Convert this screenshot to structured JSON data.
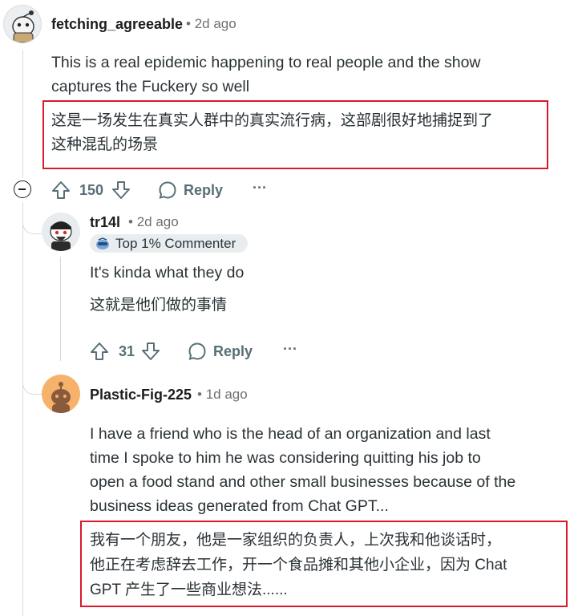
{
  "comments": [
    {
      "username": "fetching_agreeable",
      "age": "2d ago",
      "text_line1": "This is a real epidemic happening to real people and the show",
      "text_line2": "captures the Fuckery so well",
      "translation_line1": "这是一场发生在真实人群中的真实流行病，这部剧很好地捕捉到了",
      "translation_line2": "这种混乱的场景",
      "votes": "150",
      "reply_label": "Reply",
      "more_label": "···"
    },
    {
      "username": "tr14l",
      "age": "2d ago",
      "badge": "Top 1% Commenter",
      "text": "It's kinda what they do",
      "translation": "这就是他们做的事情",
      "votes": "31",
      "reply_label": "Reply",
      "more_label": "···"
    },
    {
      "username": "Plastic-Fig-225",
      "age": "1d ago",
      "text_line1": "I have a friend who is the head of an organization and last",
      "text_line2": "time I spoke to him he was considering quitting his job to",
      "text_line3": "open a food stand and other small businesses because of the",
      "text_line4": "business ideas generated from Chat GPT...",
      "translation_line1": "我有一个朋友，他是一家组织的负责人，上次我和他谈话时，",
      "translation_line2": "他正在考虑辞去工作，开一个食品摊和其他小企业，因为 Chat",
      "translation_line3": "GPT 产生了一些商业想法......"
    }
  ],
  "separator": "•",
  "colors": {
    "highlight_border": "#d9192c",
    "muted": "#576f76"
  }
}
